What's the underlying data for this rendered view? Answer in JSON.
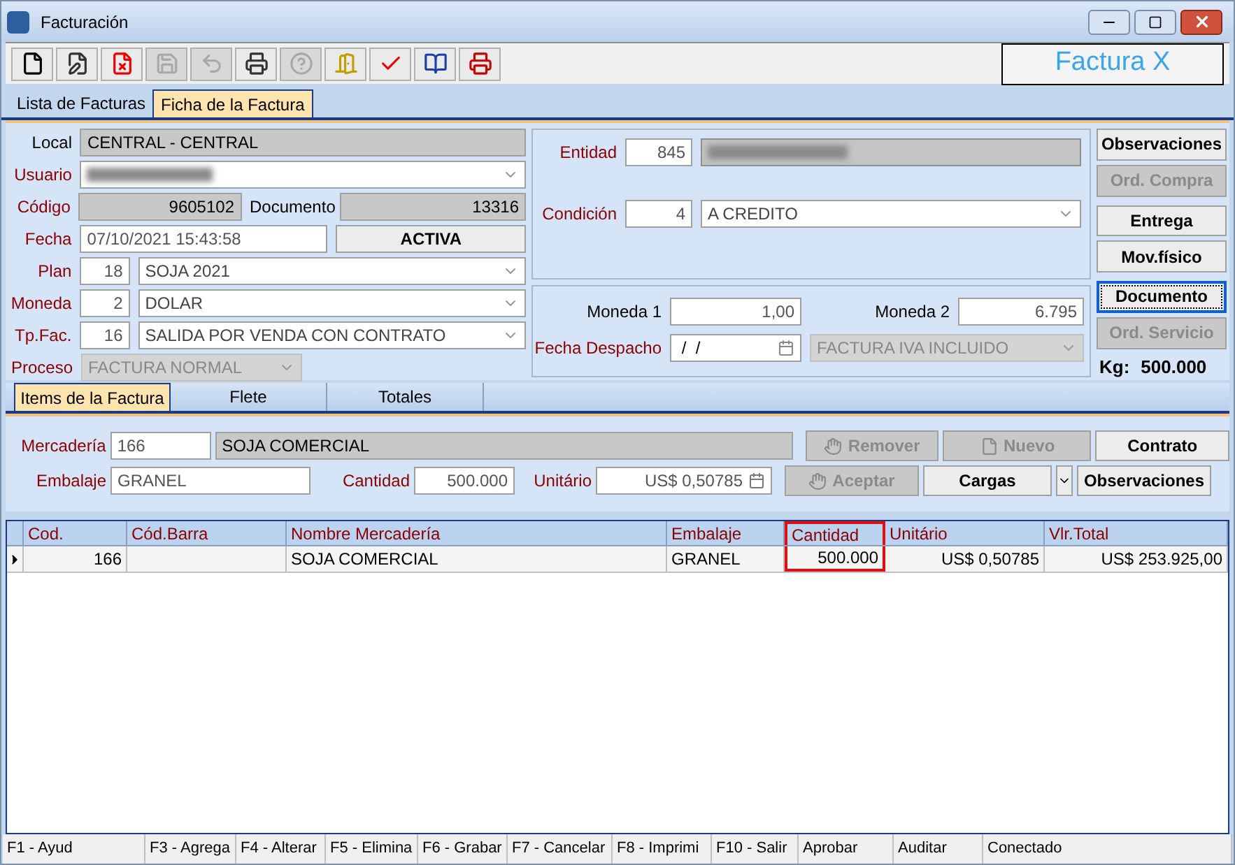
{
  "window": {
    "title": "Facturación"
  },
  "toolbar": [
    {
      "kind": "new",
      "disabled": false
    },
    {
      "kind": "edit",
      "disabled": false
    },
    {
      "kind": "delete",
      "disabled": false
    },
    {
      "kind": "save",
      "disabled": true
    },
    {
      "kind": "undo",
      "disabled": true
    },
    {
      "kind": "print",
      "disabled": false
    },
    {
      "kind": "help",
      "disabled": true
    },
    {
      "kind": "exit",
      "disabled": false
    },
    {
      "kind": "approve",
      "disabled": false
    },
    {
      "kind": "book",
      "disabled": false
    },
    {
      "kind": "print-cancel",
      "disabled": false
    }
  ],
  "logo": {
    "text": "Factura X"
  },
  "tabs": [
    {
      "label": "Lista de Facturas",
      "selected": false
    },
    {
      "label": "Ficha de la Factura",
      "selected": true
    }
  ],
  "form": {
    "local": {
      "label": "Local",
      "value": "CENTRAL  - CENTRAL"
    },
    "usuario": {
      "label": "Usuario"
    },
    "codigo": {
      "label": "Código",
      "value": "9605102"
    },
    "documento": {
      "label": "Documento",
      "value": "13316"
    },
    "fecha": {
      "label": "Fecha",
      "value": "07/10/2021 15:43:58"
    },
    "status": "ACTIVA",
    "plan": {
      "label": "Plan",
      "code": "18",
      "value": "SOJA 2021"
    },
    "moneda": {
      "label": "Moneda",
      "code": "2",
      "value": "DOLAR"
    },
    "tpfac": {
      "label": "Tp.Fac.",
      "code": "16",
      "value": "SALIDA POR VENDA CON CONTRATO"
    },
    "proceso": {
      "label": "Proceso",
      "value": "FACTURA NORMAL",
      "disabled": true
    },
    "entidad": {
      "label": "Entidad",
      "code": "845"
    },
    "condicion": {
      "label": "Condición",
      "code": "4",
      "value": "A CREDITO"
    },
    "moneda1": {
      "label": "Moneda 1",
      "value": "1,00"
    },
    "moneda2": {
      "label": "Moneda 2",
      "value": "6.795"
    },
    "fecha_despacho": {
      "label": "Fecha Despacho",
      "value": " /  /"
    },
    "iva": {
      "value": "FACTURA IVA INCLUIDO",
      "disabled": true
    }
  },
  "side_buttons": [
    {
      "label": "Observaciones",
      "disabled": false,
      "focused": false
    },
    {
      "label": "Ord. Compra",
      "disabled": true,
      "focused": false
    },
    {
      "label": "Entrega",
      "disabled": false,
      "focused": false
    },
    {
      "label": "Mov.físico",
      "disabled": false,
      "focused": false
    },
    {
      "label": "Documento",
      "disabled": false,
      "focused": true
    },
    {
      "label": "Ord. Servicio",
      "disabled": true,
      "focused": false
    }
  ],
  "kg": {
    "label": "Kg:",
    "value": "500.000"
  },
  "item_tabs": [
    {
      "label": "Items de la Factura",
      "selected": true
    },
    {
      "label": "Flete",
      "selected": false
    },
    {
      "label": "Totales",
      "selected": false
    }
  ],
  "item_form": {
    "mercaderia": {
      "label": "Mercadería",
      "code": "166",
      "value": "SOJA COMERCIAL"
    },
    "embalaje": {
      "label": "Embalaje",
      "value": "GRANEL"
    },
    "cantidad": {
      "label": "Cantidad",
      "value": "500.000"
    },
    "unitario": {
      "label": "Unitário",
      "value": "US$ 0,50785"
    }
  },
  "item_buttons": [
    {
      "label": "Remover",
      "disabled": true
    },
    {
      "label": "Nuevo",
      "disabled": true
    },
    {
      "label": "Contrato",
      "disabled": false
    },
    {
      "label": "Aceptar",
      "disabled": true
    },
    {
      "label": "Cargas",
      "disabled": false
    },
    {
      "label": "Observaciones",
      "disabled": false
    }
  ],
  "table": {
    "columns": [
      {
        "label": "Cod.",
        "highlighted": false
      },
      {
        "label": "Cód.Barra",
        "highlighted": false
      },
      {
        "label": "Nombre Mercadería",
        "highlighted": false
      },
      {
        "label": "Embalaje",
        "highlighted": false
      },
      {
        "label": "Cantidad",
        "highlighted": true
      },
      {
        "label": "Unitário",
        "highlighted": false
      },
      {
        "label": "Vlr.Total",
        "highlighted": false
      }
    ],
    "rows": [
      {
        "selected": true,
        "cells": [
          "166",
          "",
          "SOJA COMERCIAL",
          "GRANEL",
          "500.000",
          "US$ 0,50785",
          "US$ 253.925,00"
        ]
      }
    ]
  },
  "status_bar": [
    "F1 - Ayud",
    "F3 - Agrega",
    "F4 - Alterar",
    "F5 - Elimina",
    "F6 - Grabar",
    "F7 - Cancelar",
    "F8 - Imprimi",
    "F10 - Salir",
    "Aprobar",
    "Auditar",
    "Conectado"
  ]
}
